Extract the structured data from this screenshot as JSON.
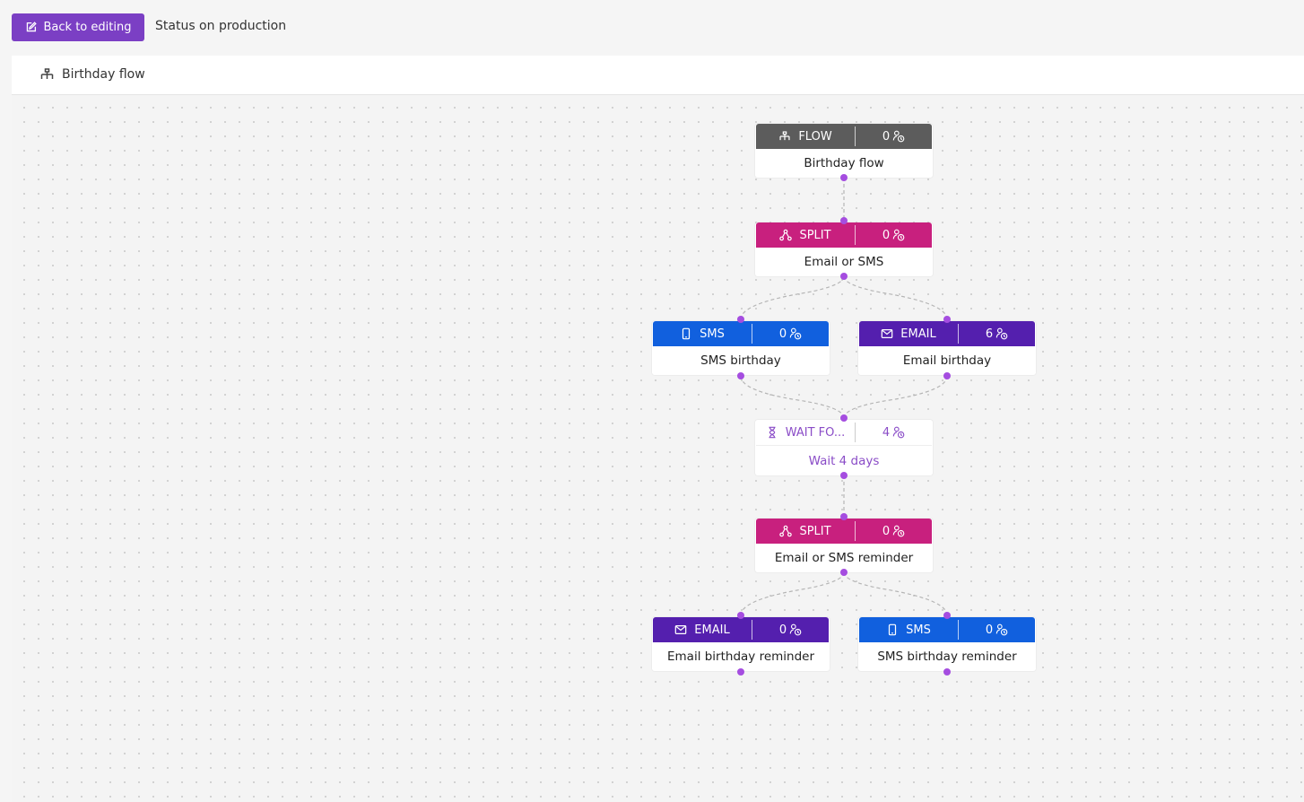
{
  "toolbar": {
    "back_label": "Back to editing",
    "status": "Status on production"
  },
  "flow": {
    "title": "Birthday flow"
  },
  "colors": {
    "flow": "#5c5c5c",
    "split": "#c8207e",
    "sms": "#1160de",
    "email": "#541fae",
    "wait": "#8a4cc7",
    "accent": "#7b3fc4"
  },
  "nodes": [
    {
      "type": "FLOW",
      "count": "0",
      "label": "Birthday flow",
      "icon": "flow-icon"
    },
    {
      "type": "SPLIT",
      "count": "0",
      "label": "Email or SMS",
      "icon": "split-icon"
    },
    {
      "type": "SMS",
      "count": "0",
      "label": "SMS birthday",
      "icon": "phone-icon"
    },
    {
      "type": "EMAIL",
      "count": "6",
      "label": "Email birthday",
      "icon": "mail-icon"
    },
    {
      "type": "WAIT FO...",
      "count": "4",
      "label": "Wait 4 days",
      "icon": "hourglass-icon"
    },
    {
      "type": "SPLIT",
      "count": "0",
      "label": "Email or SMS reminder",
      "icon": "split-icon"
    },
    {
      "type": "EMAIL",
      "count": "0",
      "label": "Email birthday reminder",
      "icon": "mail-icon"
    },
    {
      "type": "SMS",
      "count": "0",
      "label": "SMS birthday reminder",
      "icon": "phone-icon"
    }
  ]
}
